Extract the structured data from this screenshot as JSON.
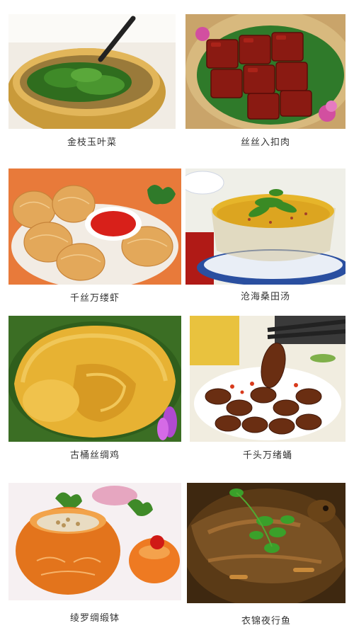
{
  "dishes": [
    {
      "name": "金枝玉叶菜"
    },
    {
      "name": "丝丝入扣肉"
    },
    {
      "name": "千丝万缕虾"
    },
    {
      "name": "沧海桑田汤"
    },
    {
      "name": "古桶丝绸鸡"
    },
    {
      "name": "千头万绪蛹"
    },
    {
      "name": "绫罗绸缎钵"
    },
    {
      "name": "衣锦夜行鱼"
    }
  ]
}
